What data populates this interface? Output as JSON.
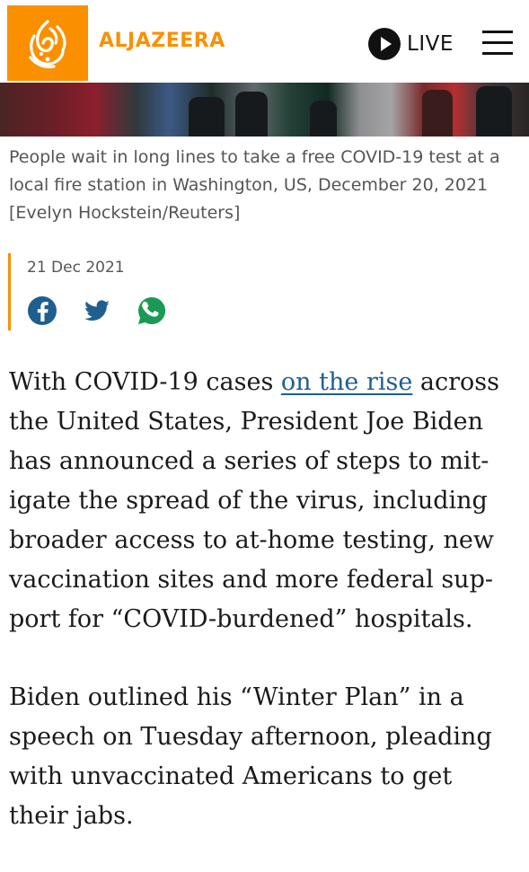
{
  "header": {
    "brand": "ALJAZEERA",
    "live_label": "LIVE",
    "icons": {
      "logo": "aljazeera-logo-icon",
      "live": "play-circle-icon",
      "menu": "hamburger-menu-icon"
    }
  },
  "colors": {
    "accent": "#fa9000",
    "link": "#1f5f8f",
    "text": "#1a1a1a",
    "caption": "#555555"
  },
  "image": {
    "caption": "People wait in long lines to take a free COVID-19 test at a local fire station in Washington, US, December 20, 2021 [Evelyn Hockstein/Reuters]"
  },
  "article": {
    "date": "21 Dec 2021",
    "share": [
      "facebook-icon",
      "twitter-icon",
      "whatsapp-icon"
    ],
    "p1": [
      "With COVID-19 cases ",
      "on the rise",
      " across",
      "the United States, President Joe Biden",
      "has announced a series of steps to mit-",
      "igate the spread of the virus, including",
      "broader access to at-home testing, new",
      "vaccination sites and more federal sup-",
      "port for “COVID-burdened” hospitals."
    ],
    "p2": [
      "Biden outlined his “Winter Plan” in a",
      "speech on Tuesday afternoon, pleading",
      "with unvaccinated Americans to get",
      "their jabs."
    ]
  }
}
